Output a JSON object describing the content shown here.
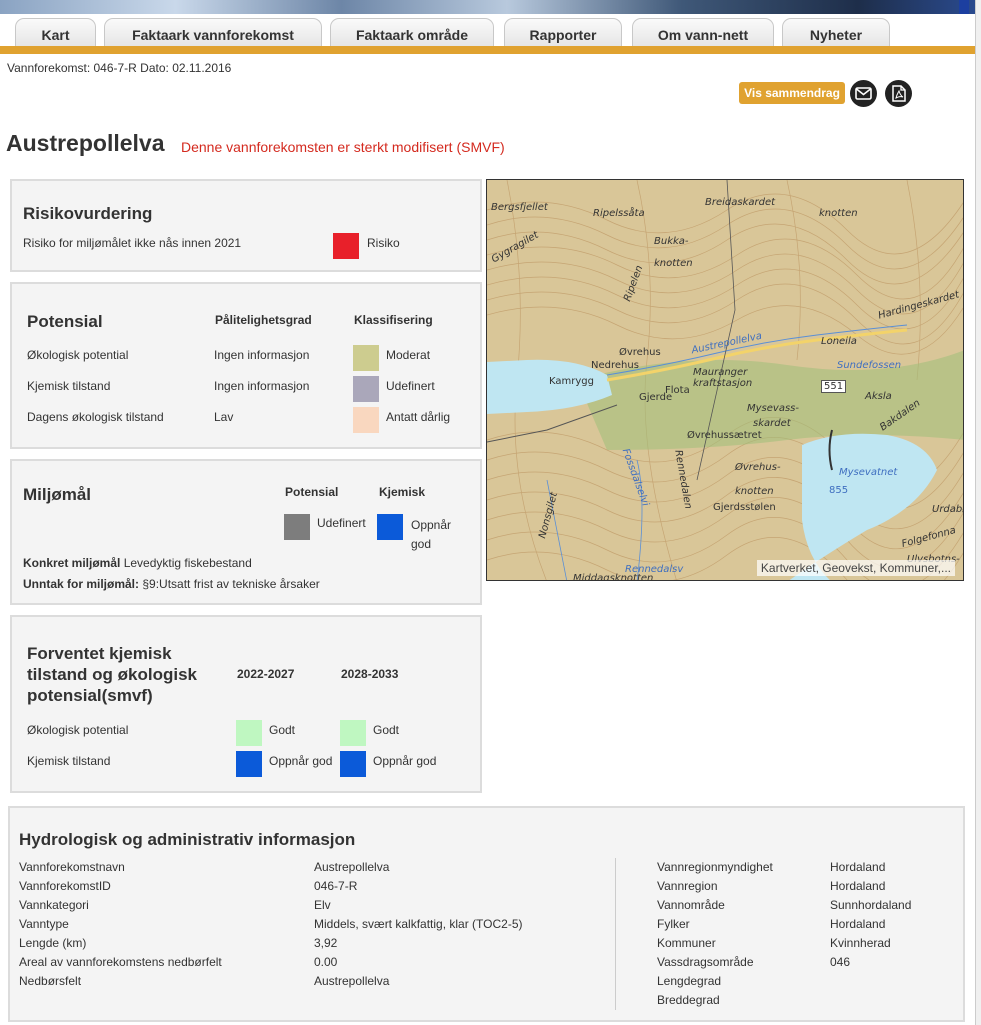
{
  "nav": {
    "tabs": [
      "Kart",
      "Faktaark vannforekomst",
      "Faktaark område",
      "Rapporter",
      "Om vann-nett",
      "Nyheter"
    ]
  },
  "meta_line": "Vannforekomst: 046-7-R Dato: 02.11.2016",
  "actions": {
    "summary_label": "Vis sammendrag"
  },
  "title": "Austrepollelva",
  "title_note": "Denne vannforekomsten er sterkt modifisert (SMVF)",
  "risk": {
    "heading": "Risikovurdering",
    "label": "Risiko for miljømålet ikke nås innen 2021",
    "value": "Risiko",
    "color": "#e8202a"
  },
  "potential": {
    "heading": "Potensial",
    "col_reliability": "Pålitelighetsgrad",
    "col_class": "Klassifisering",
    "rows": [
      {
        "label": "Økologisk potential",
        "reliability": "Ingen informasjon",
        "class": "Moderat",
        "color": "#cdcc8f"
      },
      {
        "label": "Kjemisk tilstand",
        "reliability": "Ingen informasjon",
        "class": "Udefinert",
        "color": "#aaa7ba"
      },
      {
        "label": "Dagens økologisk tilstand",
        "reliability": "Lav",
        "class": "Antatt dårlig",
        "color": "#f9d7bf"
      }
    ]
  },
  "goals": {
    "heading": "Miljømål",
    "col_potential": "Potensial",
    "col_chemical": "Kjemisk",
    "potential_value": "Udefinert",
    "potential_color": "#7d7d7d",
    "chemical_value": "Oppnår god",
    "chemical_color": "#0b5ad9",
    "concrete_label": "Konkret miljømål",
    "concrete_value": "Levedyktig fiskebestand",
    "exception_label": "Unntak for miljømål:",
    "exception_value": "§9:Utsatt frist av tekniske årsaker"
  },
  "forecast": {
    "heading": "Forventet kjemisk tilstand og økologisk potensial(smvf)",
    "period1": "2022-2027",
    "period2": "2028-2033",
    "rows": [
      {
        "label": "Økologisk potential",
        "v1": "Godt",
        "c1": "#bff7c1",
        "v2": "Godt",
        "c2": "#bff7c1"
      },
      {
        "label": "Kjemisk tilstand",
        "v1": "Oppnår god",
        "c1": "#0b5ad9",
        "v2": "Oppnår god",
        "c2": "#0b5ad9"
      }
    ]
  },
  "map": {
    "attribution": "Kartverket, Geovekst, Kommuner,...",
    "labels": [
      "Bergsfjellet",
      "Ripelssåta",
      "Breidaskardet",
      "knotten",
      "Gygragilet",
      "Bukka-",
      "knotten",
      "Ripelen",
      "Hardingeskardet",
      "Øvrehus",
      "Nedrehus",
      "Austrepollelva",
      "Loneila",
      "Kamrygg",
      "Mauranger",
      "kraftstasjon",
      "Sundefossen",
      "Flota",
      "Gjerde",
      "551",
      "Aksla",
      "Mysevass-",
      "skardet",
      "Bakdalen",
      "Øvrehussætret",
      "Fossdalselvi",
      "Rennedalen",
      "Øvrehus-",
      "knotten",
      "Mysevatnet",
      "855",
      "Gjerdsstølen",
      "Urdabø",
      "Nonsgilet",
      "Folgefonna",
      "Ulvsbotns-",
      "Rennedalsv",
      "Middagsknotten"
    ]
  },
  "hydro": {
    "heading": "Hydrologisk og administrativ informasjon",
    "left": [
      {
        "k": "Vannforekomstnavn",
        "v": "Austrepollelva"
      },
      {
        "k": "VannforekomstID",
        "v": "046-7-R"
      },
      {
        "k": "Vannkategori",
        "v": "Elv"
      },
      {
        "k": "Vanntype",
        "v": "Middels, svært kalkfattig, klar (TOC2-5)"
      },
      {
        "k": "Lengde (km)",
        "v": "3,92"
      },
      {
        "k": "Areal av vannforekomstens nedbørfelt",
        "v": "0.00"
      },
      {
        "k": "Nedbørsfelt",
        "v": "Austrepollelva"
      }
    ],
    "right": [
      {
        "k": "Vannregionmyndighet",
        "v": "Hordaland"
      },
      {
        "k": "Vannregion",
        "v": "Hordaland"
      },
      {
        "k": "Vannområde",
        "v": "Sunnhordaland"
      },
      {
        "k": "Fylker",
        "v": "Hordaland"
      },
      {
        "k": "Kommuner",
        "v": "Kvinnherad"
      },
      {
        "k": "Vassdragsområde",
        "v": "046"
      },
      {
        "k": "Lengdegrad",
        "v": ""
      },
      {
        "k": "Breddegrad",
        "v": ""
      }
    ]
  }
}
